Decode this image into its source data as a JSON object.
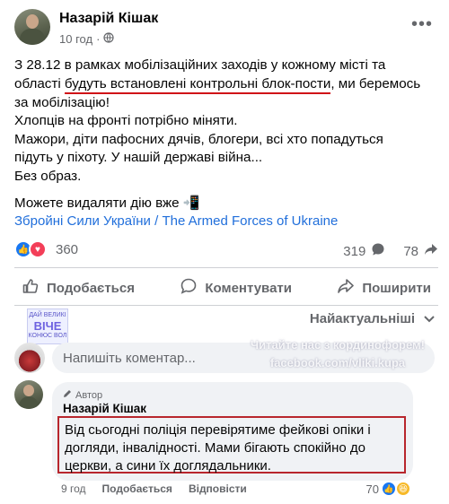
{
  "post": {
    "author": "Назарій Кішак",
    "time": "10 год",
    "privacy_icon": "globe-icon",
    "more_icon": "more-icon",
    "lines": [
      "З 28.12 в рамках мобілізаційних заходів у кожному місті та"
    ],
    "line2_pre": "області ",
    "line2_highlight": "будуть встановлені контрольні блок-пости",
    "line2_post": ", ми беремось",
    "line3": "за мобілізацію!",
    "line4": "Хлопців на фронті потрібно міняти.",
    "line5": "Мажори, діти пафосних дячів, блогери, всі хто попадуться",
    "line6": "підуть у піхоту. У нашій державі війна...",
    "line7": "Без образ.",
    "line8": "Можете видаляти дію вже 📲",
    "hashtag": "Збройні Сили України / The Armed Forces of Ukraine"
  },
  "stats": {
    "reactions": "360",
    "comments": "319",
    "shares": "78"
  },
  "actions": {
    "like": "Подобається",
    "comment": "Коментувати",
    "share": "Поширити"
  },
  "sort_label": "Найактуальніші",
  "overlay": {
    "logo_top": "ДАЙ ВЕЛИКІ",
    "logo_big": "ВІЧЕ",
    "logo_bottom": "КОНЮС ВОЛ",
    "watermark_line1": "Читайте нас з кординофорем!",
    "watermark_line2": "facebook.com/vliki.kupa"
  },
  "comment_input": {
    "placeholder": "Напишіть коментар..."
  },
  "reply": {
    "badge": "Автор",
    "author": "Назарій Кішак",
    "text": "Від сьогодні поліція перевірятиме фейкові опіки і догляди, інвалідності. Мами бігають спокійно до церкви, а сини їх доглядальники.",
    "time": "9 год",
    "like": "Подобається",
    "reply_label": "Відповісти",
    "reactions": "70"
  },
  "colors": {
    "link": "#216fdb",
    "highlight_border": "#b8262d",
    "like_blue": "#1877f2",
    "love_red": "#f33e58"
  }
}
